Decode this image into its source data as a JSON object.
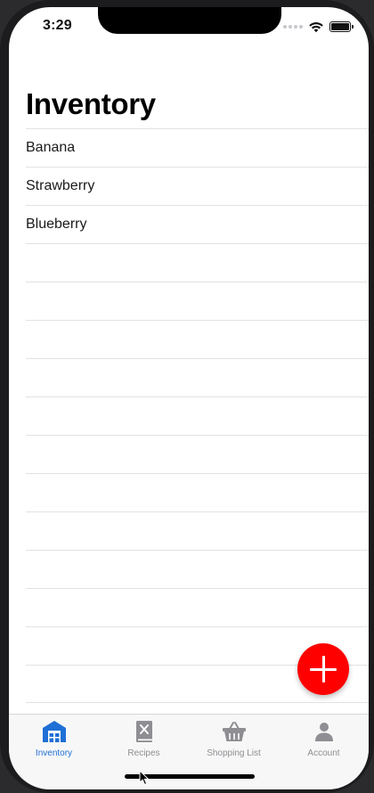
{
  "status_bar": {
    "time": "3:29",
    "icons": [
      "cellular-dots-icon",
      "wifi-icon",
      "battery-icon"
    ]
  },
  "page": {
    "title": "Inventory"
  },
  "inventory": {
    "items": [
      {
        "label": "Banana"
      },
      {
        "label": "Strawberry"
      },
      {
        "label": "Blueberry"
      },
      {
        "label": ""
      },
      {
        "label": ""
      },
      {
        "label": ""
      },
      {
        "label": ""
      },
      {
        "label": ""
      },
      {
        "label": ""
      },
      {
        "label": ""
      },
      {
        "label": ""
      },
      {
        "label": ""
      },
      {
        "label": ""
      },
      {
        "label": ""
      },
      {
        "label": ""
      }
    ]
  },
  "fab": {
    "icon": "plus-icon",
    "color": "#ff0000"
  },
  "tab_bar": {
    "tabs": [
      {
        "label": "Inventory",
        "icon": "warehouse-icon",
        "active": true
      },
      {
        "label": "Recipes",
        "icon": "recipe-book-icon",
        "active": false
      },
      {
        "label": "Shopping List",
        "icon": "basket-icon",
        "active": false
      },
      {
        "label": "Account",
        "icon": "person-icon",
        "active": false
      }
    ],
    "active_color": "#1f6fd6",
    "inactive_color": "#8e8e93"
  }
}
